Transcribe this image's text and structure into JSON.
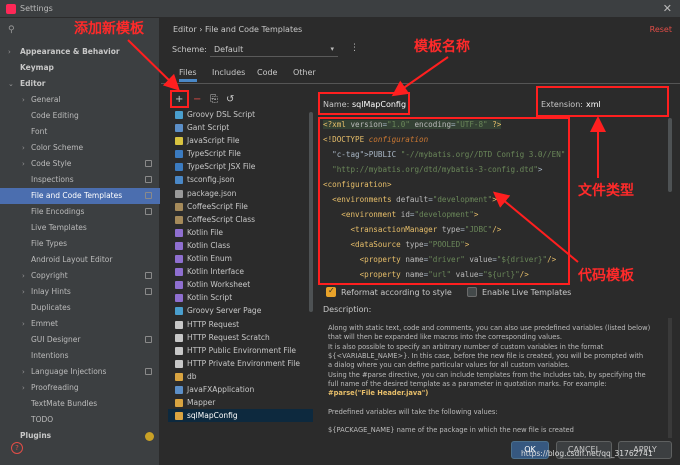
{
  "window": {
    "title": "Settings",
    "close_glyph": "✕"
  },
  "search": {
    "icon": "search-icon",
    "placeholder": ""
  },
  "sidebar": {
    "items": [
      {
        "label": "Appearance & Behavior",
        "level": 0,
        "arrow": "›",
        "bold": true
      },
      {
        "label": "Keymap",
        "level": 0,
        "arrow": "",
        "bold": true
      },
      {
        "label": "Editor",
        "level": 0,
        "arrow": "⌄",
        "bold": true
      },
      {
        "label": "General",
        "level": 1,
        "arrow": "›"
      },
      {
        "label": "Code Editing",
        "level": 1,
        "arrow": ""
      },
      {
        "label": "Font",
        "level": 1,
        "arrow": ""
      },
      {
        "label": "Color Scheme",
        "level": 1,
        "arrow": "›"
      },
      {
        "label": "Code Style",
        "level": 1,
        "arrow": "›",
        "copy": true
      },
      {
        "label": "Inspections",
        "level": 1,
        "arrow": "",
        "copy": true
      },
      {
        "label": "File and Code Templates",
        "level": 1,
        "arrow": "",
        "copy": true,
        "selected": true
      },
      {
        "label": "File Encodings",
        "level": 1,
        "arrow": "",
        "copy": true
      },
      {
        "label": "Live Templates",
        "level": 1,
        "arrow": ""
      },
      {
        "label": "File Types",
        "level": 1,
        "arrow": ""
      },
      {
        "label": "Android Layout Editor",
        "level": 1,
        "arrow": ""
      },
      {
        "label": "Copyright",
        "level": 1,
        "arrow": "›",
        "copy": true
      },
      {
        "label": "Inlay Hints",
        "level": 1,
        "arrow": "›",
        "copy": true
      },
      {
        "label": "Duplicates",
        "level": 1,
        "arrow": ""
      },
      {
        "label": "Emmet",
        "level": 1,
        "arrow": "›"
      },
      {
        "label": "GUI Designer",
        "level": 1,
        "arrow": "",
        "copy": true
      },
      {
        "label": "Intentions",
        "level": 1,
        "arrow": ""
      },
      {
        "label": "Language Injections",
        "level": 1,
        "arrow": "›",
        "copy": true
      },
      {
        "label": "Proofreading",
        "level": 1,
        "arrow": "›"
      },
      {
        "label": "TextMate Bundles",
        "level": 1,
        "arrow": ""
      },
      {
        "label": "TODO",
        "level": 1,
        "arrow": ""
      },
      {
        "label": "Plugins",
        "level": 0,
        "arrow": "",
        "bold": true,
        "badge": true
      }
    ]
  },
  "header": {
    "breadcrumb": "Editor  ›  File and Code Templates",
    "reset": "Reset",
    "scheme_label": "Scheme:",
    "scheme_value": "Default",
    "scheme_chevron": "▾",
    "more_glyph": "⋮"
  },
  "tabs": [
    "Files",
    "Includes",
    "Code",
    "Other"
  ],
  "toolbar": {
    "add": "+",
    "remove": "−",
    "copy": "⎘",
    "reset": "↺"
  },
  "files": [
    {
      "label": "Groovy DSL Script",
      "icon_color": "#4a9fce"
    },
    {
      "label": "Gant Script",
      "icon_color": "#5c8fc8"
    },
    {
      "label": "JavaScript File",
      "icon_color": "#d9c440"
    },
    {
      "label": "TypeScript File",
      "icon_color": "#3b7bc0"
    },
    {
      "label": "TypeScript JSX File",
      "icon_color": "#3b7bc0"
    },
    {
      "label": "tsconfig.json",
      "icon_color": "#4a88c7"
    },
    {
      "label": "package.json",
      "icon_color": "#9a9a9a"
    },
    {
      "label": "CoffeeScript File",
      "icon_color": "#a58a5a"
    },
    {
      "label": "CoffeeScript Class",
      "icon_color": "#a58a5a"
    },
    {
      "label": "Kotlin File",
      "icon_color": "#8f6fd0"
    },
    {
      "label": "Kotlin Class",
      "icon_color": "#8f6fd0"
    },
    {
      "label": "Kotlin Enum",
      "icon_color": "#8f6fd0"
    },
    {
      "label": "Kotlin Interface",
      "icon_color": "#8f6fd0"
    },
    {
      "label": "Kotlin Worksheet",
      "icon_color": "#8f6fd0"
    },
    {
      "label": "Kotlin Script",
      "icon_color": "#8f6fd0"
    },
    {
      "label": "Groovy Server Page",
      "icon_color": "#4a9fce"
    },
    {
      "label": "HTTP Request",
      "icon_color": "#c8c8c8"
    },
    {
      "label": "HTTP Request Scratch",
      "icon_color": "#c8c8c8"
    },
    {
      "label": "HTTP Public Environment File",
      "icon_color": "#c8c8c8"
    },
    {
      "label": "HTTP Private Environment File",
      "icon_color": "#c8c8c8"
    },
    {
      "label": "db",
      "icon_color": "#d9a441"
    },
    {
      "label": "JavaFXApplication",
      "icon_color": "#5c8fc8"
    },
    {
      "label": "Mapper",
      "icon_color": "#d9a441"
    },
    {
      "label": "sqlMapConfig",
      "icon_color": "#d9a441",
      "selected": true
    }
  ],
  "form": {
    "name_label": "Name:",
    "name_value": "sqlMapConfig",
    "extension_label": "Extension:",
    "extension_value": "xml"
  },
  "editor": {
    "lines": [
      "<?xml version=\"1.0\" encoding=\"UTF-8\" ?>",
      "<!DOCTYPE configuration",
      "  PUBLIC \"-//mybatis.org//DTD Config 3.0//EN\"",
      "  \"http://mybatis.org/dtd/mybatis-3-config.dtd\">",
      "<configuration>",
      "  <environments default=\"development\">",
      "    <environment id=\"development\">",
      "      <transactionManager type=\"JDBC\"/>",
      "      <dataSource type=\"POOLED\">",
      "        <property name=\"driver\" value=\"${driver}\"/>",
      "        <property name=\"url\" value=\"${url}\"/>"
    ]
  },
  "options": {
    "reformat_label": "Reformat according to style",
    "reformat_checked": true,
    "live_label": "Enable Live Templates",
    "live_checked": false
  },
  "description": {
    "title": "Description:",
    "lines": [
      "Along with static text, code and comments, you can also use predefined variables (listed below)",
      "that will then be expanded like macros into the corresponding values.",
      "It is also possible to specify an arbitrary number of custom variables in the format",
      "${<VARIABLE_NAME>}. In this case, before the new file is created, you will be prompted with",
      "a dialog where you can define particular values for all custom variables.",
      "Using the #parse directive, you can include templates from the Includes tab, by specifying the",
      "full name of the desired template as a parameter in quotation marks. For example:",
      "#parse(\"File Header.java\")",
      "",
      "Predefined variables will take the following values:",
      "",
      "${PACKAGE_NAME}                    name of the package in which the new file is created"
    ]
  },
  "buttons": {
    "help": "?",
    "ok": "OK",
    "cancel": "CANCEL",
    "apply": "APPLY"
  },
  "watermark": "https://blog.csdn.net/qq_31762741",
  "annotations": {
    "add_template": "添加新模板",
    "template_name": "模板名称",
    "file_type": "文件类型",
    "code_template": "代码模板"
  },
  "colors": {
    "accent": "#4a88c7",
    "selection": "#4b6eaf",
    "annotation": "#ff1f1f",
    "reset": "#e24d47",
    "checkbox": "#e9a32a"
  }
}
